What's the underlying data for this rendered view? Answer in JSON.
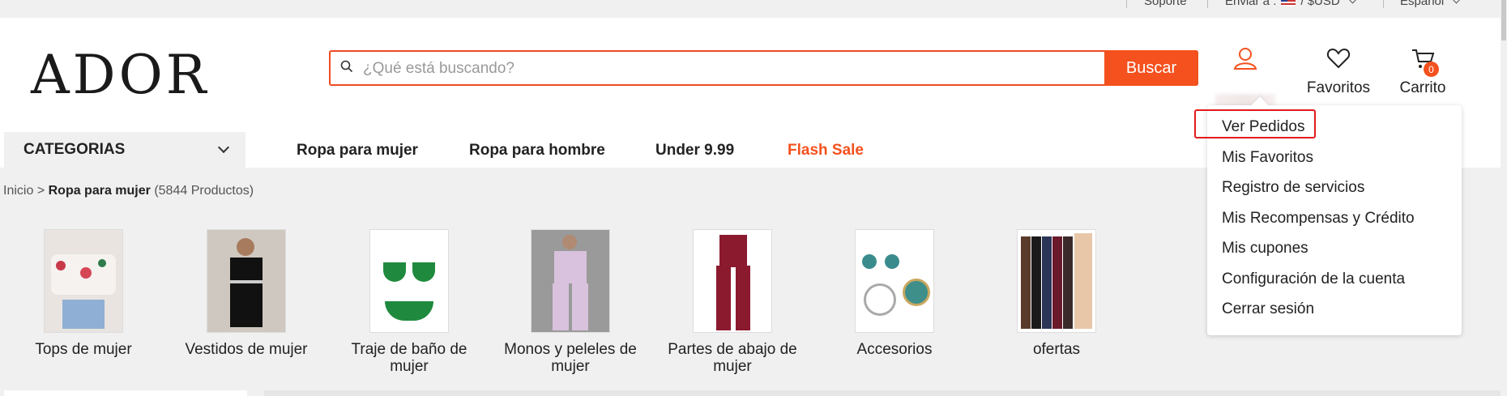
{
  "topbar": {
    "support": "Soporte",
    "ship_to_label": "Enviar a :",
    "currency": "/ $USD",
    "language": "Español"
  },
  "header": {
    "logo": "ADOR",
    "search_placeholder": "¿Qué está buscando?",
    "search_button": "Buscar",
    "favorites_label": "Favoritos",
    "cart_label": "Carrito",
    "cart_count": "0"
  },
  "nav": {
    "categories_label": "CATEGORIAS",
    "links": [
      "Ropa para mujer",
      "Ropa para hombre",
      "Under 9.99",
      "Flash Sale"
    ]
  },
  "breadcrumb": {
    "home": "Inicio",
    "separator": ">",
    "current": "Ropa para mujer",
    "count": "(5844 Productos)"
  },
  "categories": [
    {
      "name": "Tops de mujer",
      "icon": "floral-top-image"
    },
    {
      "name": "Vestidos de mujer",
      "icon": "black-dress-image"
    },
    {
      "name": "Traje de baño de mujer",
      "icon": "green-bikini-image"
    },
    {
      "name": "Monos y peleles de mujer",
      "icon": "pink-jumpsuit-image"
    },
    {
      "name": "Partes de abajo de mujer",
      "icon": "red-pants-image"
    },
    {
      "name": "Accesorios",
      "icon": "jewelry-set-image"
    },
    {
      "name": "ofertas",
      "icon": "leggings-image"
    }
  ],
  "account_menu": {
    "items": [
      "Ver Pedidos",
      "Mis Favoritos",
      "Registro de servicios",
      "Mis Recompensas y Crédito",
      "Mis cupones",
      "Configuración de la cuenta",
      "Cerrar sesión"
    ],
    "highlighted": "Ver Pedidos"
  },
  "colors": {
    "accent": "#f4511e",
    "highlight_border": "#e21b1b",
    "flash_sale": "#f4511e"
  }
}
